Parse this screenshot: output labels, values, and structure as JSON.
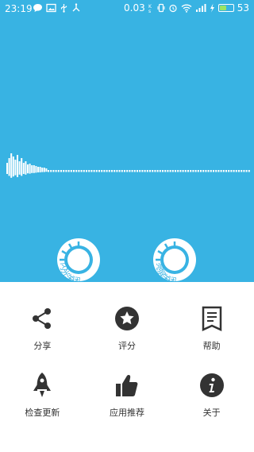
{
  "colors": {
    "accent": "#38b3e3",
    "sheet_bg": "#ffffff",
    "icon": "#333333",
    "battery": "#9be564"
  },
  "status_bar": {
    "time": "23:19",
    "net_speed": "0.03",
    "battery_level": "53",
    "battery_fraction": 0.53
  },
  "dials": [
    {
      "label": "闪光关闭"
    },
    {
      "label": "亮屏关闭"
    }
  ],
  "menu": {
    "items": [
      {
        "label": "分享",
        "icon": "share-icon"
      },
      {
        "label": "评分",
        "icon": "star-icon"
      },
      {
        "label": "帮助",
        "icon": "book-icon"
      },
      {
        "label": "检查更新",
        "icon": "rocket-icon"
      },
      {
        "label": "应用推荐",
        "icon": "thumbs-up-icon"
      },
      {
        "label": "关于",
        "icon": "info-icon"
      }
    ]
  }
}
